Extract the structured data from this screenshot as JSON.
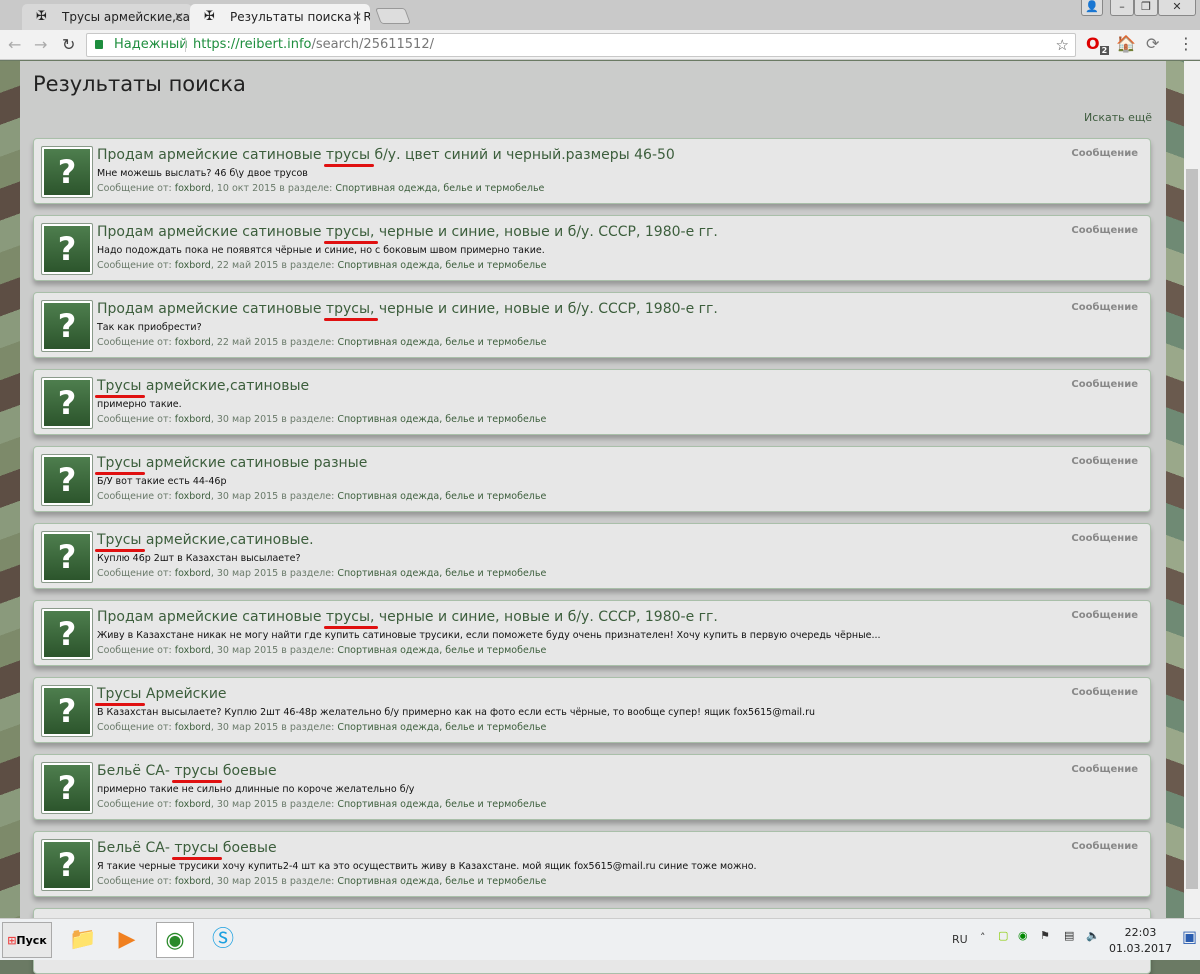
{
  "tabs": [
    {
      "label": "Трусы армейские,сатино",
      "icon": "iron-cross-icon"
    },
    {
      "label": "Результаты поиска | REI",
      "icon": "iron-cross-icon"
    }
  ],
  "address": {
    "secure_label": "Надежный",
    "url_host": "https://reibert.info",
    "url_path": "/search/25611512/"
  },
  "extensions": {
    "opera_badge": "2"
  },
  "page": {
    "title": "Результаты поиска",
    "search_more": "Искать ещё"
  },
  "results": [
    {
      "pre": "Продам армейские сатиновые ",
      "hl": "трусы",
      "post": " б/у. цвет синий и черный.размеры 46-50",
      "snippet": "Мне можешь выслать? 46 б\\у двое трусов",
      "meta_prefix": "Сообщение от: ",
      "author": "foxbord",
      "date": ", 10 окт 2015 в разделе: ",
      "forum": "Спортивная одежда, белье и термобелье",
      "type": "Сообщение"
    },
    {
      "pre": "Продам армейские сатиновые ",
      "hl": "трусы,",
      "post": " черные и синие, новые и б/у. СССР, 1980-е гг.",
      "snippet": "Надо подождать пока не появятся чёрные и синие, но с боковым швом примерно такие.",
      "meta_prefix": "Сообщение от: ",
      "author": "foxbord",
      "date": ", 22 май 2015 в разделе: ",
      "forum": "Спортивная одежда, белье и термобелье",
      "type": "Сообщение"
    },
    {
      "pre": "Продам армейские сатиновые ",
      "hl": "трусы,",
      "post": " черные и синие, новые и б/у. СССР, 1980-е гг.",
      "snippet": "Так как приобрести?",
      "meta_prefix": "Сообщение от: ",
      "author": "foxbord",
      "date": ", 22 май 2015 в разделе: ",
      "forum": "Спортивная одежда, белье и термобелье",
      "type": "Сообщение"
    },
    {
      "pre": "",
      "hl": "Трусы",
      "post": " армейские,сатиновые",
      "snippet": "примерно такие.",
      "meta_prefix": "Сообщение от: ",
      "author": "foxbord",
      "date": ", 30 мар 2015 в разделе: ",
      "forum": "Спортивная одежда, белье и термобелье",
      "type": "Сообщение"
    },
    {
      "pre": "",
      "hl": "Трусы",
      "post": " армейские сатиновые разные",
      "snippet": "Б/У вот такие есть 44-46р",
      "meta_prefix": "Сообщение от: ",
      "author": "foxbord",
      "date": ", 30 мар 2015 в разделе: ",
      "forum": "Спортивная одежда, белье и термобелье",
      "type": "Сообщение"
    },
    {
      "pre": "",
      "hl": "Трусы",
      "post": " армейские,сатиновые.",
      "snippet": "Куплю 46р 2шт в Казахстан высылаете?",
      "meta_prefix": "Сообщение от: ",
      "author": "foxbord",
      "date": ", 30 мар 2015 в разделе: ",
      "forum": "Спортивная одежда, белье и термобелье",
      "type": "Сообщение"
    },
    {
      "pre": "Продам армейские сатиновые ",
      "hl": "трусы,",
      "post": " черные и синие, новые и б/у. СССР, 1980-е гг.",
      "snippet": "Живу в Казахстане никак не могу найти где купить сатиновые трусики, если поможете буду очень признателен! Хочу купить в первую очередь чёрные...",
      "meta_prefix": "Сообщение от: ",
      "author": "foxbord",
      "date": ", 30 мар 2015 в разделе: ",
      "forum": "Спортивная одежда, белье и термобелье",
      "type": "Сообщение"
    },
    {
      "pre": "",
      "hl": "Трусы",
      "post": " Армейские",
      "snippet": "В Казахстан высылаете? Куплю 2шт 46-48р желательно б/у примерно как на фото если есть чёрные, то вообще супер! ящик fox5615@mail.ru",
      "meta_prefix": "Сообщение от: ",
      "author": "foxbord",
      "date": ", 30 мар 2015 в разделе: ",
      "forum": "Спортивная одежда, белье и термобелье",
      "type": "Сообщение"
    },
    {
      "pre": "Бельё СА- ",
      "hl": "трусы",
      "post": " боевые",
      "snippet": "примерно такие не сильно длинные по короче желательно б/у",
      "meta_prefix": "Сообщение от: ",
      "author": "foxbord",
      "date": ", 30 мар 2015 в разделе: ",
      "forum": "Спортивная одежда, белье и термобелье",
      "type": "Сообщение"
    },
    {
      "pre": "Бельё СА- ",
      "hl": "трусы",
      "post": " боевые",
      "snippet": "Я такие черные трусики хочу купить2-4 шт ка это осуществить живу в Казахстане. мой ящик fox5615@mail.ru синие тоже можно.",
      "meta_prefix": "Сообщение от: ",
      "author": "foxbord",
      "date": ", 30 мар 2015 в разделе: ",
      "forum": "Спортивная одежда, белье и термобелье",
      "type": "Сообщение"
    }
  ],
  "avatar_glyph": "?",
  "taskbar": {
    "start": "Пуск",
    "lang": "RU",
    "time": "22:03",
    "date": "01.03.2017"
  }
}
